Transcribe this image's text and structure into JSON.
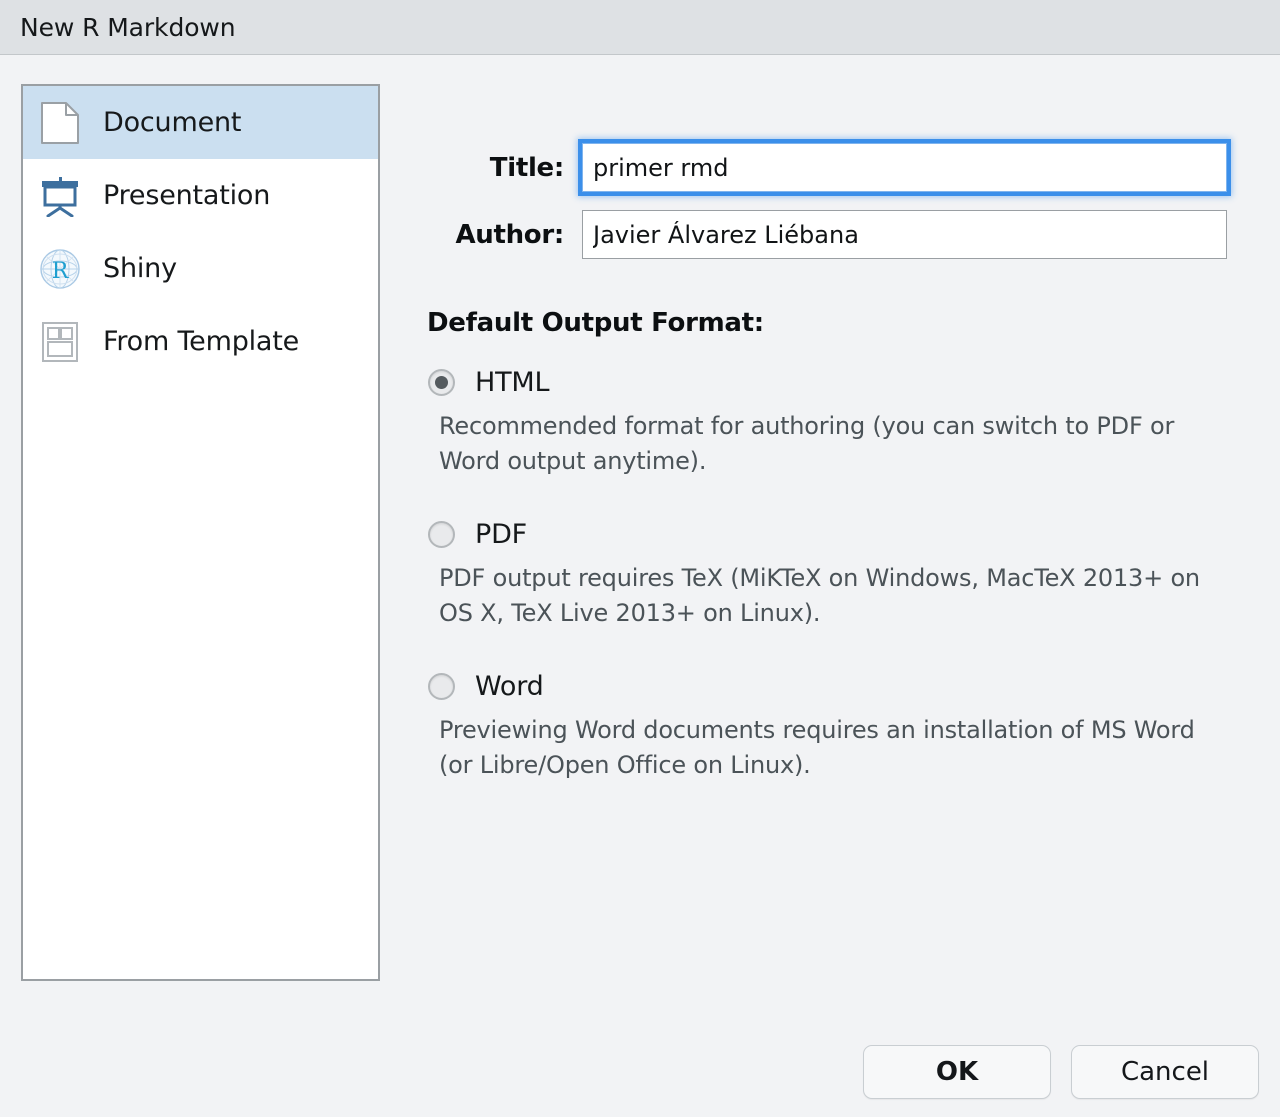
{
  "window": {
    "title": "New R Markdown"
  },
  "sidebar": {
    "items": [
      {
        "label": "Document",
        "icon": "document-icon",
        "selected": true
      },
      {
        "label": "Presentation",
        "icon": "presentation-icon",
        "selected": false
      },
      {
        "label": "Shiny",
        "icon": "shiny-globe-icon",
        "selected": false
      },
      {
        "label": "From Template",
        "icon": "template-icon",
        "selected": false
      }
    ]
  },
  "form": {
    "title_label": "Title:",
    "title_value": "primer rmd",
    "title_placeholder": "",
    "author_label": "Author:",
    "author_value": "Javier Álvarez Liébana",
    "author_placeholder": ""
  },
  "output_format": {
    "section_label": "Default Output Format:",
    "options": [
      {
        "label": "HTML",
        "selected": true,
        "description": "Recommended format for authoring (you can switch to PDF or Word output anytime)."
      },
      {
        "label": "PDF",
        "selected": false,
        "description": "PDF output requires TeX (MiKTeX on Windows, MacTeX 2013+ on OS X, TeX Live 2013+ on Linux)."
      },
      {
        "label": "Word",
        "selected": false,
        "description": "Previewing Word documents requires an installation of MS Word (or Libre/Open Office on Linux)."
      }
    ]
  },
  "footer": {
    "ok_label": "OK",
    "cancel_label": "Cancel"
  },
  "colors": {
    "titlebar_bg": "#dee1e4",
    "body_bg": "#f2f3f5",
    "selection_bg": "#cbdff0",
    "focus_ring": "#3b8fea",
    "icon_blue": "#3d6f9e",
    "shiny_cyan": "#1f9fd0",
    "desc_text": "#4b5358"
  }
}
